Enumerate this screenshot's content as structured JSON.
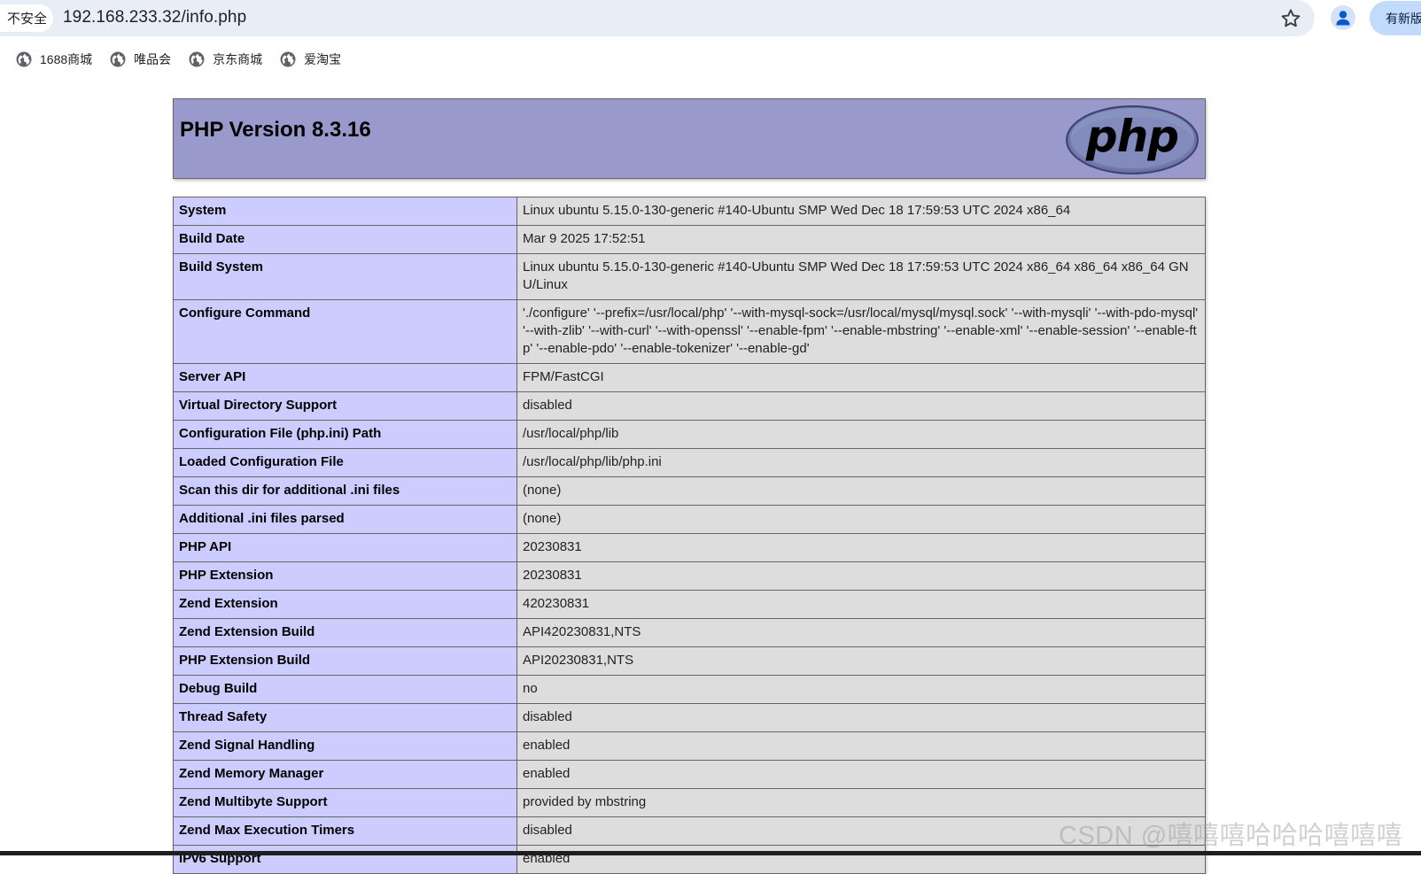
{
  "browser": {
    "security_label": "不安全",
    "warning_glyph": "⚠",
    "url": "192.168.233.32/info.php",
    "new_version_label": "有新版",
    "icons": {
      "star": "star-icon",
      "profile": "person-icon",
      "bookmark": "globe-icon"
    }
  },
  "bookmarks": [
    {
      "label": "1688商城"
    },
    {
      "label": "唯品会"
    },
    {
      "label": "京东商城"
    },
    {
      "label": "爱淘宝"
    }
  ],
  "phpinfo": {
    "title": "PHP Version 8.3.16",
    "logo_text": "php",
    "rows": [
      {
        "key": "System",
        "value": "Linux ubuntu 5.15.0-130-generic #140-Ubuntu SMP Wed Dec 18 17:59:53 UTC 2024 x86_64"
      },
      {
        "key": "Build Date",
        "value": "Mar 9 2025 17:52:51"
      },
      {
        "key": "Build System",
        "value": "Linux ubuntu 5.15.0-130-generic #140-Ubuntu SMP Wed Dec 18 17:59:53 UTC 2024 x86_64 x86_64 x86_64 GNU/Linux"
      },
      {
        "key": "Configure Command",
        "value": "'./configure' '--prefix=/usr/local/php' '--with-mysql-sock=/usr/local/mysql/mysql.sock' '--with-mysqli' '--with-pdo-mysql' '--with-zlib' '--with-curl' '--with-openssl' '--enable-fpm' '--enable-mbstring' '--enable-xml' '--enable-session' '--enable-ftp' '--enable-pdo' '--enable-tokenizer' '--enable-gd'"
      },
      {
        "key": "Server API",
        "value": "FPM/FastCGI"
      },
      {
        "key": "Virtual Directory Support",
        "value": "disabled"
      },
      {
        "key": "Configuration File (php.ini) Path",
        "value": "/usr/local/php/lib"
      },
      {
        "key": "Loaded Configuration File",
        "value": "/usr/local/php/lib/php.ini"
      },
      {
        "key": "Scan this dir for additional .ini files",
        "value": "(none)"
      },
      {
        "key": "Additional .ini files parsed",
        "value": "(none)"
      },
      {
        "key": "PHP API",
        "value": "20230831"
      },
      {
        "key": "PHP Extension",
        "value": "20230831"
      },
      {
        "key": "Zend Extension",
        "value": "420230831"
      },
      {
        "key": "Zend Extension Build",
        "value": "API420230831,NTS"
      },
      {
        "key": "PHP Extension Build",
        "value": "API20230831,NTS"
      },
      {
        "key": "Debug Build",
        "value": "no"
      },
      {
        "key": "Thread Safety",
        "value": "disabled"
      },
      {
        "key": "Zend Signal Handling",
        "value": "enabled"
      },
      {
        "key": "Zend Memory Manager",
        "value": "enabled"
      },
      {
        "key": "Zend Multibyte Support",
        "value": "provided by mbstring"
      },
      {
        "key": "Zend Max Execution Timers",
        "value": "disabled"
      },
      {
        "key": "IPv6 Support",
        "value": "enabled"
      }
    ]
  },
  "watermark": "CSDN @嘻嘻嘻哈哈哈嘻嘻嘻",
  "colors": {
    "header_bg": "#9999cc",
    "key_cell_bg": "#ccccff",
    "value_cell_bg": "#dddddd",
    "omnibox_bg": "#e9eef6"
  }
}
